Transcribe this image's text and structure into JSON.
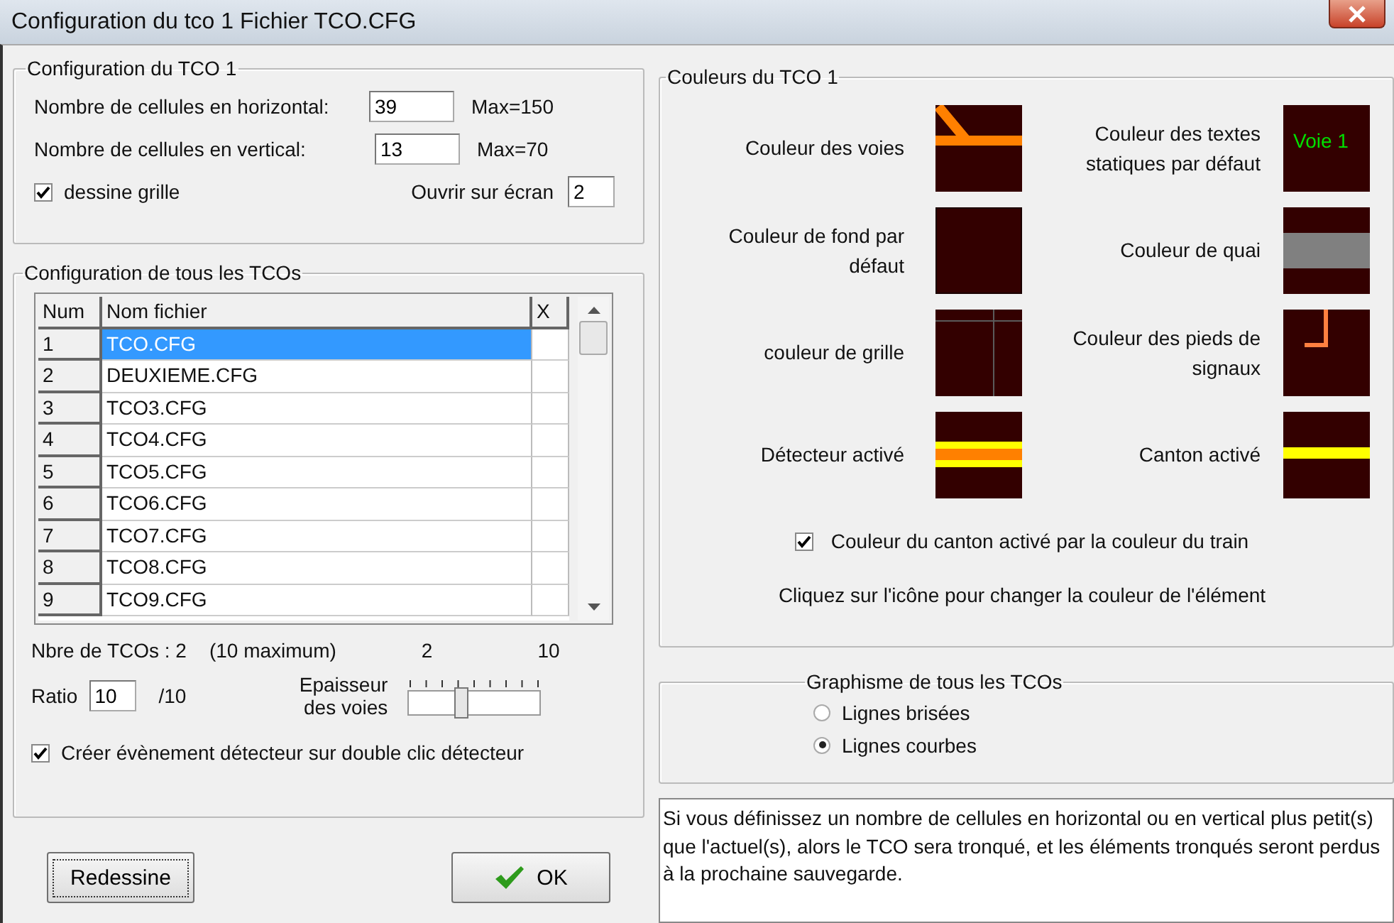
{
  "window": {
    "title": "Configuration du tco 1 Fichier TCO.CFG"
  },
  "tco_config": {
    "title": "Configuration du TCO 1",
    "fields": [
      {
        "label": "Nombre de cellules en horizontal:",
        "value": "39",
        "max": "Max=150"
      },
      {
        "label": "Nombre de cellules en vertical:",
        "value": "13",
        "max": "Max=70"
      }
    ],
    "grid_checkbox": {
      "label": "dessine grille",
      "checked": true
    },
    "screen_field": {
      "label": "Ouvrir sur écran",
      "value": "2"
    }
  },
  "all_tcos": {
    "title": "Configuration de tous les TCOs",
    "table": {
      "columns": [
        "Num",
        "Nom fichier",
        "X"
      ],
      "rows": [
        {
          "num": "1",
          "name": "TCO.CFG",
          "selected": true
        },
        {
          "num": "2",
          "name": "DEUXIEME.CFG",
          "selected": false
        },
        {
          "num": "3",
          "name": "TCO3.CFG",
          "selected": false
        },
        {
          "num": "4",
          "name": "TCO4.CFG",
          "selected": false
        },
        {
          "num": "5",
          "name": "TCO5.CFG",
          "selected": false
        },
        {
          "num": "6",
          "name": "TCO6.CFG",
          "selected": false
        },
        {
          "num": "7",
          "name": "TCO7.CFG",
          "selected": false
        },
        {
          "num": "8",
          "name": "TCO8.CFG",
          "selected": false
        },
        {
          "num": "9",
          "name": "TCO9.CFG",
          "selected": false
        }
      ]
    },
    "count": "Nbre de TCOs : 2",
    "maximum": "(10 maximum)",
    "slider": {
      "label": "Epaisseur des voies",
      "min": "2",
      "max": "10",
      "level": 0.4
    },
    "ratio": {
      "label": "Ratio",
      "value": "10",
      "suffix": "/10"
    },
    "event_checkbox": {
      "label": "Créer évènement détecteur sur double clic détecteur",
      "checked": true
    }
  },
  "buttons": [
    {
      "kind": "redraw",
      "label": "Redessine"
    },
    {
      "kind": "ok",
      "label": "OK"
    }
  ],
  "colors": {
    "title": "Couleurs du TCO 1",
    "swatches": [
      {
        "kind": "track",
        "label": "Couleur des voies",
        "color": "#ff8000"
      },
      {
        "kind": "text",
        "label": "Couleur des textes statiques par défaut",
        "color": "#00e000",
        "sample": "Voie 1"
      },
      {
        "kind": "background",
        "label": "Couleur de fond par défaut",
        "color": "#330000"
      },
      {
        "kind": "platform",
        "label": "Couleur de quai",
        "color": "#808080"
      },
      {
        "kind": "grid",
        "label": "couleur de grille",
        "color": "#5a5a5a"
      },
      {
        "kind": "signal",
        "label": "Couleur des pieds de signaux",
        "color": "#ff8040"
      },
      {
        "kind": "detector",
        "label": "Détecteur activé",
        "color": "#ffff00"
      },
      {
        "kind": "block",
        "label": "Canton activé",
        "color": "#ffff00"
      }
    ],
    "train_checkbox": {
      "label": "Couleur du canton activé par la couleur du train",
      "checked": true
    },
    "hint": "Cliquez sur l'icône pour changer la couleur de l'élément"
  },
  "graphics": {
    "title": "Graphisme de tous les TCOs",
    "options": [
      {
        "label": "Lignes brisées",
        "selected": false
      },
      {
        "label": "Lignes courbes",
        "selected": true
      }
    ]
  },
  "info": "Si vous définissez un nombre de cellules en horizontal ou en vertical plus petit(s) que l'actuel(s), alors le TCO sera tronqué, et les éléments tronqués seront perdus à la prochaine sauvegarde."
}
